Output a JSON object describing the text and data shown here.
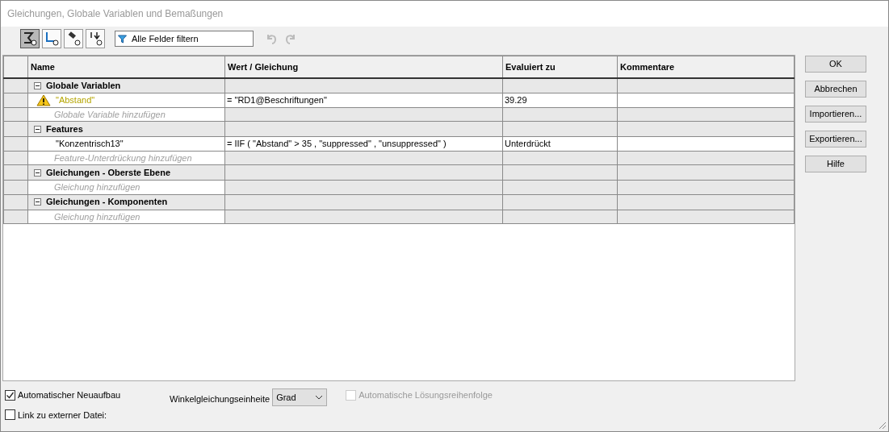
{
  "window": {
    "title": "Gleichungen, Globale Variablen und Bemaßungen"
  },
  "toolbar": {
    "view_buttons": [
      {
        "selected": true
      },
      {
        "selected": false
      },
      {
        "selected": false
      },
      {
        "selected": false
      }
    ],
    "filter": {
      "placeholder": "Alle Felder filtern"
    }
  },
  "table": {
    "columns": [
      "Name",
      "Wert / Gleichung",
      "Evaluiert zu",
      "Kommentare"
    ],
    "rows": [
      {
        "kind": "group",
        "name": "Globale Variablen",
        "expanded": true
      },
      {
        "kind": "item",
        "name": "\"Abstand\"",
        "warning": true,
        "value": "= \"RD1@Beschriftungen\"",
        "evaluates_to": "39.29"
      },
      {
        "kind": "add",
        "name": "Globale Variable hinzufügen"
      },
      {
        "kind": "group",
        "name": "Features",
        "expanded": true
      },
      {
        "kind": "item",
        "name": "\"Konzentrisch13\"",
        "warning": false,
        "value": "= IIF ( \"Abstand\" > 35 , \"suppressed\" , \"unsuppressed\" )",
        "evaluates_to": "Unterdrückt"
      },
      {
        "kind": "add",
        "name": "Feature-Unterdrückung hinzufügen"
      },
      {
        "kind": "group",
        "name": "Gleichungen - Oberste Ebene",
        "expanded": true
      },
      {
        "kind": "add",
        "name": "Gleichung hinzufügen"
      },
      {
        "kind": "group",
        "name": "Gleichungen - Komponenten",
        "expanded": true
      },
      {
        "kind": "add",
        "name": "Gleichung hinzufügen"
      }
    ]
  },
  "buttons": [
    "OK",
    "Abbrechen",
    "Importieren...",
    "Exportieren...",
    "Hilfe"
  ],
  "options": {
    "auto_rebuild": {
      "label": "Automatischer Neuaufbau",
      "checked": true
    },
    "link_file": {
      "label": "Link zu externer Datei:",
      "checked": false
    },
    "angle_unit": {
      "label": "Winkelgleichungseinheite",
      "value": "Grad"
    },
    "auto_order": {
      "label": "Automatische Lösungsreihenfolge",
      "checked": false,
      "disabled": true
    }
  }
}
